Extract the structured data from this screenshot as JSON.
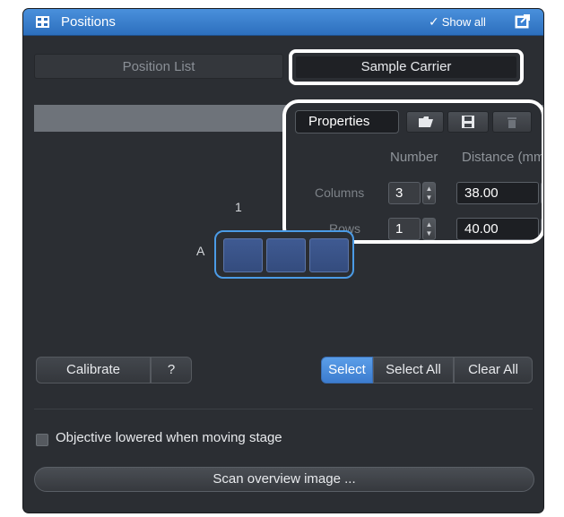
{
  "window": {
    "title": "Positions",
    "show_all_check": "✓",
    "show_all_label": "Show all"
  },
  "tabs": [
    {
      "label": "Position List"
    },
    {
      "label": "Sample Carrier"
    }
  ],
  "properties": {
    "tab_label": "Properties",
    "headers": {
      "number": "Number",
      "distance": "Distance (mm"
    },
    "rows": [
      {
        "label": "Columns",
        "number": "3",
        "distance": "38.00"
      },
      {
        "label": "Rows",
        "number": "1",
        "distance": "40.00"
      }
    ],
    "icons": [
      "folder-open-icon",
      "save-icon",
      "delete-icon"
    ]
  },
  "carrier": {
    "column_label": "1",
    "row_label": "A",
    "wells": 3
  },
  "buttons": {
    "calibrate": "Calibrate",
    "help": "?",
    "select": "Select",
    "select_all": "Select All",
    "clear_all": "Clear All",
    "scan_overview": "Scan overview image ..."
  },
  "options": {
    "objective_lowered": "Objective lowered when moving stage",
    "objective_lowered_checked": false
  },
  "colors": {
    "titlebar": "#3b82d4",
    "panel": "#2b2e33",
    "accent": "#4b9be6",
    "callout_outline": "#ffffff"
  }
}
